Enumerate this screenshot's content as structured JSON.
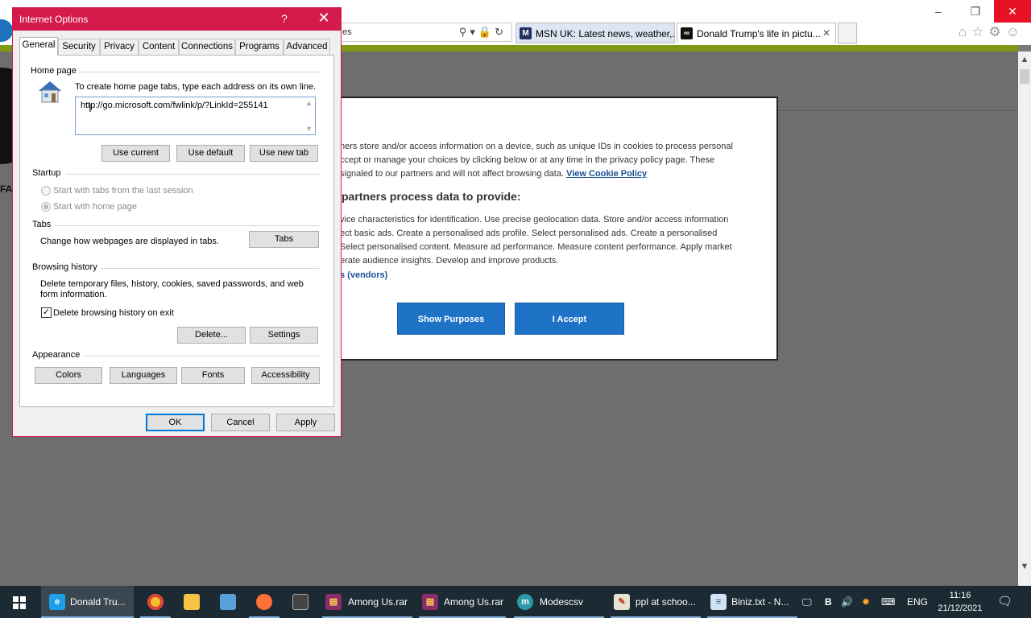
{
  "browser": {
    "address_text": "es",
    "tabs": [
      {
        "label": "MSN UK: Latest news, weather,...",
        "favicon": "msn-icon"
      },
      {
        "label": "Donald Trump's life in pictu...",
        "favicon": "site-icon"
      }
    ],
    "window_controls": {
      "minimize": "–",
      "restore": "❐",
      "close": "✕"
    }
  },
  "page": {
    "left_fragment": "FA",
    "consent": {
      "para1_line1": "ners store and/or access information on a device, such as unique IDs in cookies to process personal",
      "para1_line2": "ccept or manage your choices by clicking below or at any time in the privacy policy page. These",
      "para1_line3": "signaled to our partners and will not affect browsing data.",
      "cookie_policy_link": "View Cookie Policy",
      "heading": "partners process data to provide:",
      "para2_line1": "vice characteristics for identification. Use precise geolocation data. Store and/or access information",
      "para2_line2": "ect basic ads. Create a personalised ads profile. Select personalised ads. Create a personalised",
      "para2_line3": "Select personalised content. Measure ad performance. Measure content performance. Apply market",
      "para2_line4": "erate audience insights. Develop and improve products.",
      "vendors_link": "s (vendors)",
      "show_purposes": "Show Purposes",
      "accept": "I Accept"
    }
  },
  "dialog": {
    "title": "Internet Options",
    "help": "?",
    "close": "✕",
    "tabs": [
      "General",
      "Security",
      "Privacy",
      "Content",
      "Connections",
      "Programs",
      "Advanced"
    ],
    "active_tab": "General",
    "home_page": {
      "group": "Home page",
      "instruction": "To create home page tabs, type each address on its own line.",
      "url": "http://go.microsoft.com/fwlink/p/?LinkId=255141",
      "use_current": "Use current",
      "use_default": "Use default",
      "use_new_tab": "Use new tab"
    },
    "startup": {
      "group": "Startup",
      "option1": "Start with tabs from the last session",
      "option2": "Start with home page",
      "selected": "Start with home page"
    },
    "tabs_group": {
      "group": "Tabs",
      "description": "Change how webpages are displayed in tabs.",
      "button": "Tabs"
    },
    "browsing_history": {
      "group": "Browsing history",
      "line1": "Delete temporary files, history, cookies, saved passwords, and web",
      "line2": "form information.",
      "checkbox_label": "Delete browsing history on exit",
      "checkbox_checked": true,
      "check_mark": "✓",
      "delete": "Delete...",
      "settings": "Settings"
    },
    "appearance": {
      "group": "Appearance",
      "colors": "Colors",
      "languages": "Languages",
      "fonts": "Fonts",
      "accessibility": "Accessibility"
    },
    "ok": "OK",
    "cancel": "Cancel",
    "apply": "Apply"
  },
  "taskbar": {
    "items": [
      {
        "label": "Donald Tru...",
        "icon": "ie-icon"
      },
      {
        "label": "",
        "icon": "chrome-icon"
      },
      {
        "label": "",
        "icon": "file-explorer-icon"
      },
      {
        "label": "",
        "icon": "control-panel-icon"
      },
      {
        "label": "",
        "icon": "firefox-icon"
      },
      {
        "label": "",
        "icon": "terminal-icon"
      },
      {
        "label": "Among Us.rar",
        "icon": "winrar-icon"
      },
      {
        "label": "Among Us.rar",
        "icon": "winrar-icon"
      },
      {
        "label": "Modescsv",
        "icon": "m-app-icon"
      },
      {
        "label": "ppl at schoo...",
        "icon": "paint-icon"
      },
      {
        "label": "Biniz.txt - N...",
        "icon": "notepad-icon"
      }
    ],
    "tray": {
      "keyboard_letter": "B",
      "language": "ENG",
      "time": "11:16",
      "date": "21/12/2021"
    }
  }
}
